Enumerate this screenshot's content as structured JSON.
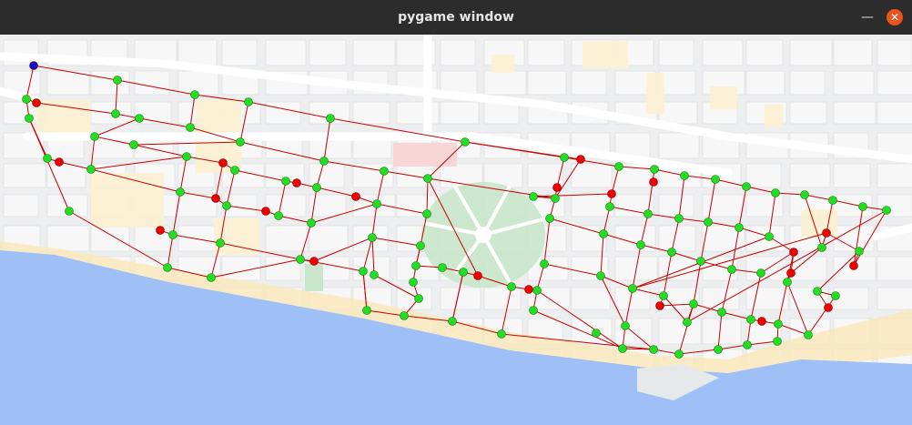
{
  "window": {
    "title": "pygame window",
    "minimize_icon": "minimize-icon",
    "close_icon": "close-icon",
    "close_color": "#e95420",
    "titlebar_color": "#2c2c2c"
  },
  "map": {
    "land_color": "#eceef0",
    "block_color": "#f7f7f8",
    "street_color": "#ffffff",
    "beach_color": "#fbe7b6",
    "park_color": "#c8e6c9",
    "water_color": "#9fbff7",
    "edge_color": "#c80000",
    "visited_node_color": "#22dd22",
    "unvisited_node_color": "#ee0000",
    "start_node_color": "#1010cc"
  }
}
